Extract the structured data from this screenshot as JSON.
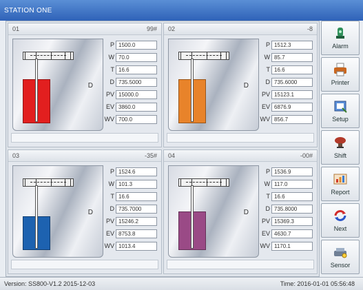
{
  "window": {
    "title": "STATION ONE"
  },
  "panels": [
    {
      "num": "01",
      "status": "99#",
      "level_color": "#e21f1f",
      "level_fraction": 0.6,
      "fields": [
        {
          "label": "P",
          "value": "1500.0"
        },
        {
          "label": "W",
          "value": "70.0"
        },
        {
          "label": "T",
          "value": "16.6"
        },
        {
          "label": "D",
          "value": "735.5000"
        },
        {
          "label": "PV",
          "value": "15000.0"
        },
        {
          "label": "EV",
          "value": "3860.0"
        },
        {
          "label": "WV",
          "value": "700.0"
        }
      ]
    },
    {
      "num": "02",
      "status": "-8",
      "level_color": "#e8832a",
      "level_fraction": 0.6,
      "fields": [
        {
          "label": "P",
          "value": "1512.3"
        },
        {
          "label": "W",
          "value": "85.7"
        },
        {
          "label": "T",
          "value": "16.6"
        },
        {
          "label": "D",
          "value": "735.6000"
        },
        {
          "label": "PV",
          "value": "15123.1"
        },
        {
          "label": "EV",
          "value": "6876.9"
        },
        {
          "label": "WV",
          "value": "856.7"
        }
      ]
    },
    {
      "num": "03",
      "status": "-35#",
      "level_color": "#1d62b0",
      "level_fraction": 0.45,
      "fields": [
        {
          "label": "P",
          "value": "1524.6"
        },
        {
          "label": "W",
          "value": "101.3"
        },
        {
          "label": "T",
          "value": "16.6"
        },
        {
          "label": "D",
          "value": "735.7000"
        },
        {
          "label": "PV",
          "value": "15246.2"
        },
        {
          "label": "EV",
          "value": "8753.8"
        },
        {
          "label": "WV",
          "value": "1013.4"
        }
      ]
    },
    {
      "num": "04",
      "status": "-00#",
      "level_color": "#9a4a86",
      "level_fraction": 0.52,
      "fields": [
        {
          "label": "P",
          "value": "1536.9"
        },
        {
          "label": "W",
          "value": "117.0"
        },
        {
          "label": "T",
          "value": "16.6"
        },
        {
          "label": "D",
          "value": "735.8000"
        },
        {
          "label": "PV",
          "value": "15369.3"
        },
        {
          "label": "EV",
          "value": "4630.7"
        },
        {
          "label": "WV",
          "value": "1170.1"
        }
      ]
    }
  ],
  "sidebar": [
    {
      "label": "Alarm",
      "icon": "alarm-icon"
    },
    {
      "label": "Printer",
      "icon": "printer-icon"
    },
    {
      "label": "Setup",
      "icon": "setup-icon"
    },
    {
      "label": "Shift",
      "icon": "shift-icon"
    },
    {
      "label": "Report",
      "icon": "report-icon"
    },
    {
      "label": "Next",
      "icon": "next-icon"
    },
    {
      "label": "Sensor",
      "icon": "sensor-icon"
    }
  ],
  "statusbar": {
    "version": "Version: SS800-V1.2 2015-12-03",
    "time": "Time: 2016-01-01 05:56:48"
  }
}
